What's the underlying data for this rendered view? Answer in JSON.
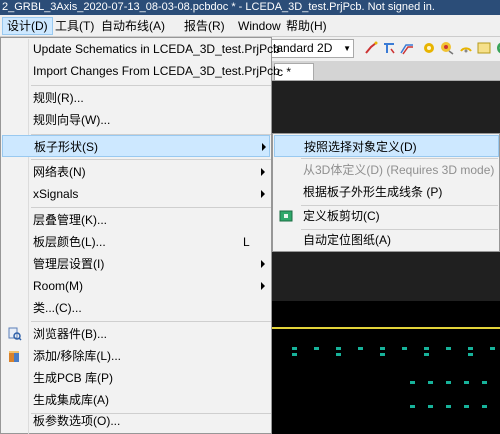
{
  "window": {
    "title": "2_GRBL_3Axis_2020-07-13_08-03-08.pcbdoc * - LCEDA_3D_test.PrjPcb. Not signed in."
  },
  "menubar": [
    {
      "label": "设计(D)"
    },
    {
      "label": "工具(T)"
    },
    {
      "label": "自动布线(A)"
    },
    {
      "label": "报告(R)"
    },
    {
      "label": "Window"
    },
    {
      "label": "帮助(H)"
    }
  ],
  "toolbar": {
    "view_mode": "tandard 2D"
  },
  "doc_tab": {
    "label": "c *"
  },
  "menu": {
    "items": [
      {
        "label": "Update Schematics in LCEDA_3D_test.PrjPcb"
      },
      {
        "label": "Import Changes From LCEDA_3D_test.PrjPcb"
      },
      {
        "label": "规则(R)..."
      },
      {
        "label": "规则向导(W)..."
      },
      {
        "label": "板子形状(S)"
      },
      {
        "label": "网络表(N)"
      },
      {
        "label": "xSignals"
      },
      {
        "label": "层叠管理(K)..."
      },
      {
        "label": "板层颜色(L)...",
        "shortcut": "L"
      },
      {
        "label": "管理层设置(I)"
      },
      {
        "label": "Room(M)"
      },
      {
        "label": "类...(C)..."
      },
      {
        "label": "浏览器件(B)..."
      },
      {
        "label": "添加/移除库(L)..."
      },
      {
        "label": "生成PCB 库(P)"
      },
      {
        "label": "生成集成库(A)"
      },
      {
        "label": "板参数选项(O)..."
      }
    ]
  },
  "submenu": {
    "items": [
      {
        "label": "按照选择对象定义(D)",
        "enabled": true
      },
      {
        "label": "从3D体定义(D) (Requires 3D mode)",
        "enabled": false
      },
      {
        "label": "根据板子外形生成线条 (P)",
        "enabled": true
      },
      {
        "label": "定义板剪切(C)",
        "enabled": true
      },
      {
        "label": "自动定位图纸(A)",
        "enabled": true
      }
    ]
  },
  "colors": {
    "highlight": "#cde8ff",
    "title_bar": "#2b4d78",
    "canvas": "#000000",
    "board_outline": "#e2d33a",
    "pads": "#17b29a"
  }
}
